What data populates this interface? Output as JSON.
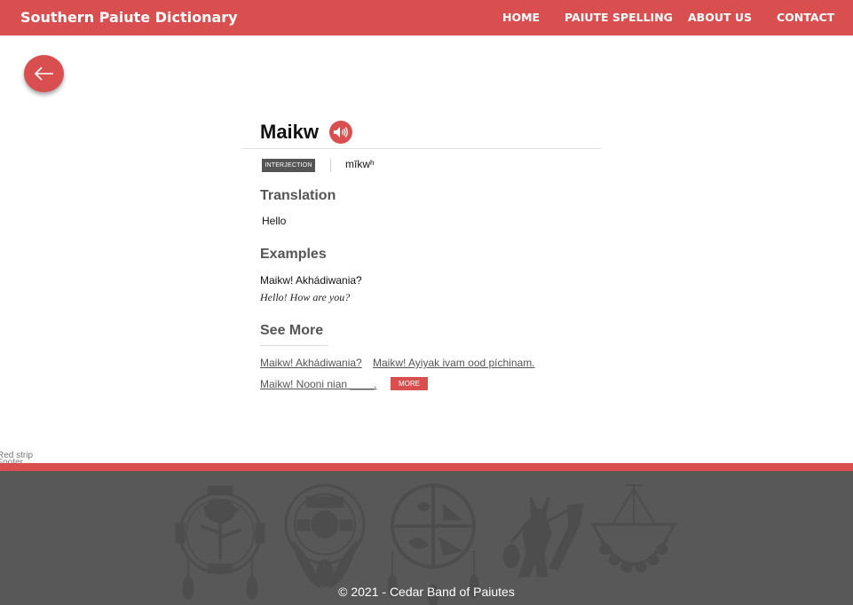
{
  "header": {
    "brand": "Southern Paiute Dictionary",
    "nav": [
      "HOME",
      "PAIUTE SPELLING",
      "ABOUT US",
      "CONTACT"
    ]
  },
  "back_button": {
    "icon": "arrow-left-icon"
  },
  "entry": {
    "word": "Maikw",
    "audio_icon": "speaker-icon",
    "part_of_speech": "INTERJECTION",
    "pronunciation": "mīkwʰ"
  },
  "translation": {
    "heading": "Translation",
    "text": "Hello"
  },
  "examples": {
    "heading": "Examples",
    "items": [
      {
        "paiute": "Maikw! Akhádiwania?",
        "english": "Hello! How are you?"
      }
    ]
  },
  "see_more": {
    "heading": "See More",
    "links": [
      "Maikw! Akhádiwania?",
      "Maikw! Ayiyak ivam ood píchinam.",
      "Maikw! Nooni nian ____."
    ],
    "more_label": "MORE"
  },
  "debug_labels": {
    "strip": "Red strip",
    "footer": "Footer"
  },
  "footer": {
    "copyright": "© 2021 - Cedar Band of Paiutes",
    "emblems": [
      "tree-dreamcatcher-emblem",
      "shield-feathers-emblem",
      "medicine-wheel-emblem",
      "dancer-figure-emblem",
      "basket-emblem"
    ]
  },
  "colors": {
    "accent": "#d94f50",
    "footer_bg": "#585858",
    "badge_bg": "#555555"
  }
}
